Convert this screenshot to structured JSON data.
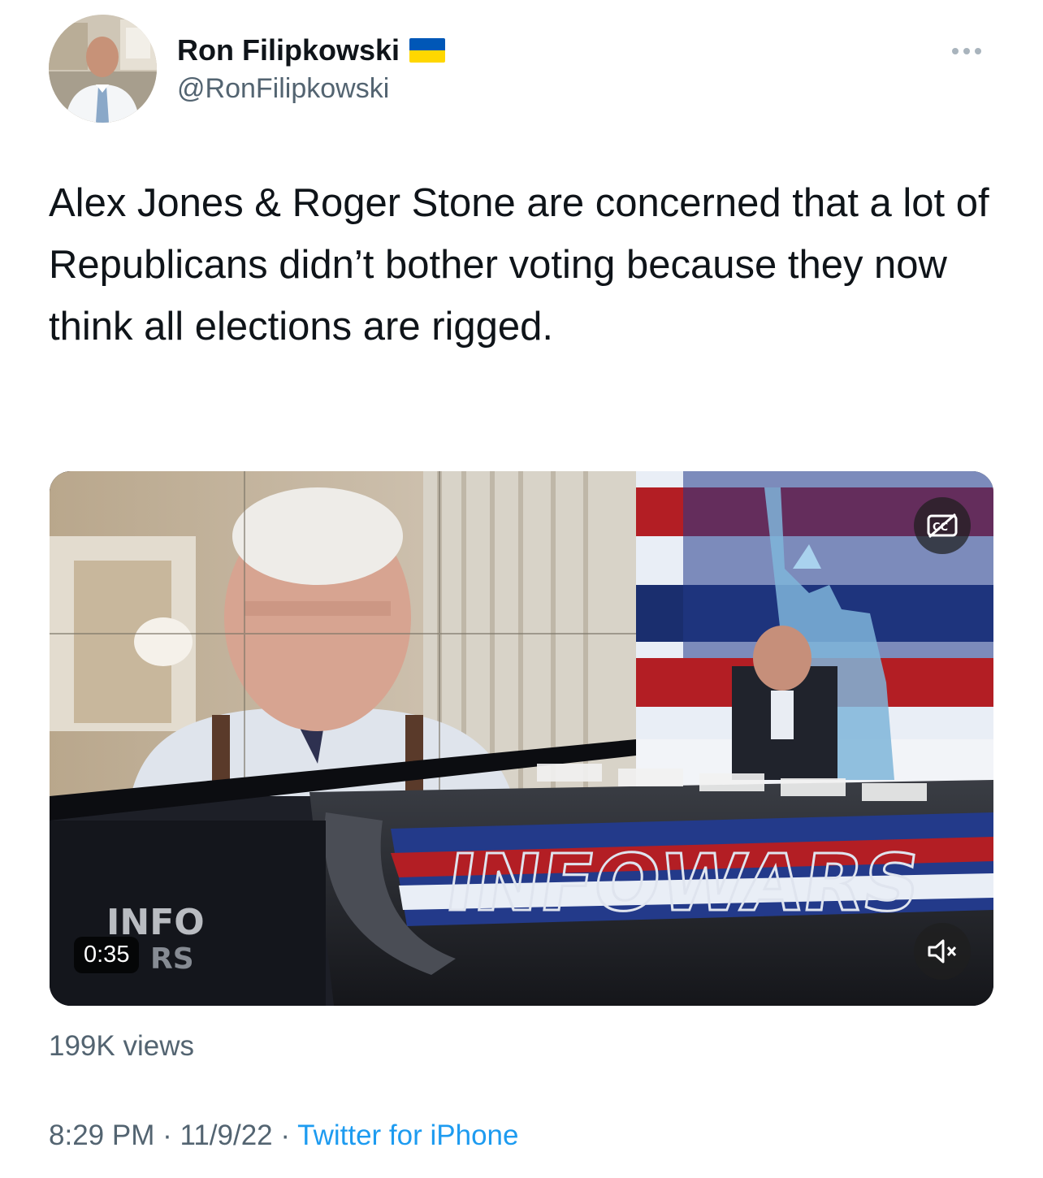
{
  "tweet": {
    "author": {
      "display_name": "Ron Filipkowski",
      "handle": "@RonFilipkowski",
      "flag_icon": "ukraine-flag",
      "flag_colors": [
        "#0057b7",
        "#ffd700"
      ]
    },
    "text": "Alex Jones & Roger Stone are concerned that a lot of Republicans didn’t bother voting because they now think all elections are rigged.",
    "media": {
      "duration": "0:35",
      "overlay_text": "INFOWARS",
      "corner_logo": "INFO",
      "corner_logo_sub": "RS",
      "cc_icon": "closed-captions-off-icon",
      "mute_icon": "speaker-muted-icon"
    },
    "views": "199K views",
    "time": "8:29 PM",
    "separator": " · ",
    "date": "11/9/22",
    "source": "Twitter for iPhone"
  },
  "colors": {
    "text_primary": "#0f1419",
    "text_secondary": "#536471",
    "link": "#1d9bf0"
  }
}
